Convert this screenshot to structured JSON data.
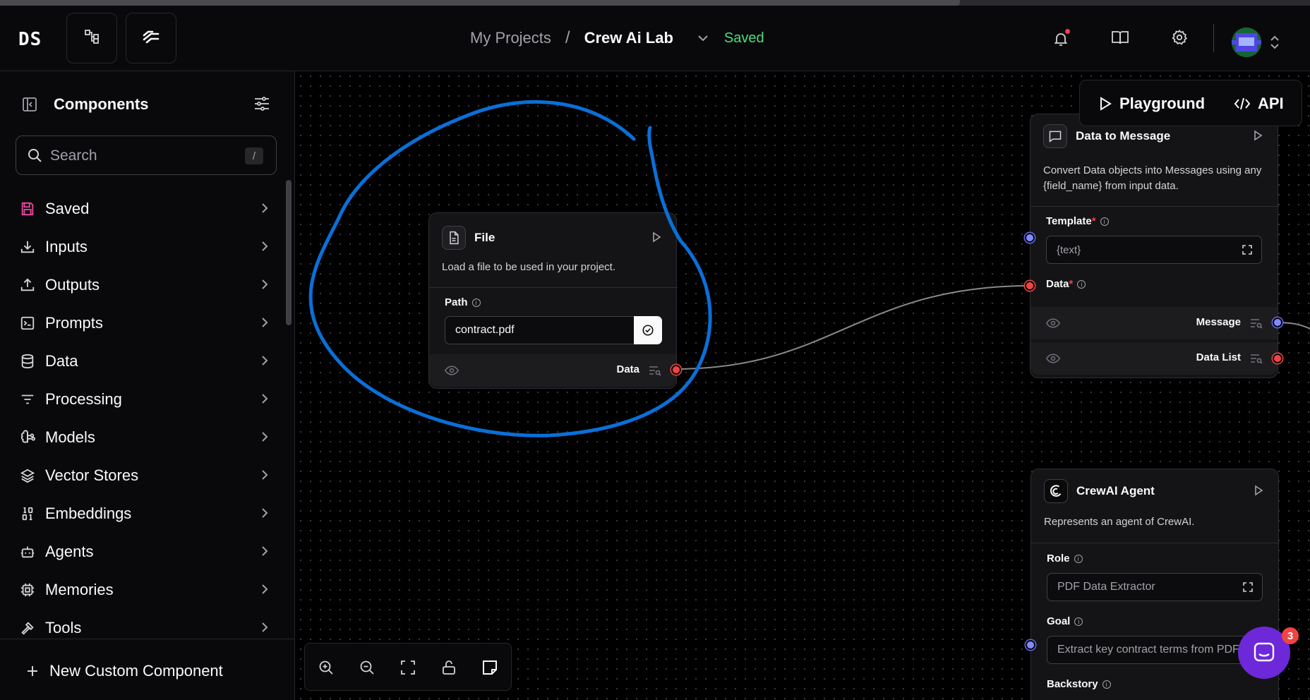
{
  "header": {
    "logo": "DS",
    "breadcrumb": {
      "projects": "My Projects",
      "separator": "/",
      "current": "Crew Ai Lab"
    },
    "status": "Saved",
    "icons": [
      "flow-icon",
      "langflow-icon",
      "bell-icon",
      "docs-icon",
      "gear-icon",
      "avatar",
      "chevron-updown-icon"
    ]
  },
  "sidebar": {
    "title": "Components",
    "search": {
      "placeholder": "Search",
      "shortcut": "/"
    },
    "items": [
      {
        "label": "Saved",
        "icon": "save-icon"
      },
      {
        "label": "Inputs",
        "icon": "download-icon"
      },
      {
        "label": "Outputs",
        "icon": "upload-icon"
      },
      {
        "label": "Prompts",
        "icon": "terminal-icon"
      },
      {
        "label": "Data",
        "icon": "database-icon"
      },
      {
        "label": "Processing",
        "icon": "list-filter-icon"
      },
      {
        "label": "Models",
        "icon": "brain-icon"
      },
      {
        "label": "Vector Stores",
        "icon": "layers-icon"
      },
      {
        "label": "Embeddings",
        "icon": "binary-icon"
      },
      {
        "label": "Agents",
        "icon": "bot-icon"
      },
      {
        "label": "Memories",
        "icon": "cpu-icon"
      },
      {
        "label": "Tools",
        "icon": "hammer-icon"
      }
    ],
    "new_component": "New Custom Component"
  },
  "toolbar": {
    "playground": "Playground",
    "api": "API"
  },
  "nodes": {
    "file": {
      "title": "File",
      "description": "Load a file to be used in your project.",
      "path_label": "Path",
      "path_value": "contract.pdf",
      "output_label": "Data"
    },
    "data_to_message": {
      "title": "Data to Message",
      "description_line1": "Convert Data objects into Messages using any",
      "description_line2": "{field_name} from input data.",
      "template_label": "Template",
      "template_value": "{text}",
      "data_label": "Data",
      "outputs": [
        "Message",
        "Data List"
      ]
    },
    "crewai_agent": {
      "title": "CrewAI Agent",
      "description": "Represents an agent of CrewAI.",
      "role_label": "Role",
      "role_value": "PDF Data Extractor",
      "goal_label": "Goal",
      "goal_value": "Extract key contract terms from PDF",
      "backstory_label": "Backstory"
    }
  },
  "colors": {
    "accent_saved": "#4ade80",
    "handle_red": "#ef4444",
    "handle_blue": "#818cf8",
    "annotation": "#0a6fd8",
    "chat": "#6d28d9"
  },
  "chat": {
    "badge": "3"
  }
}
